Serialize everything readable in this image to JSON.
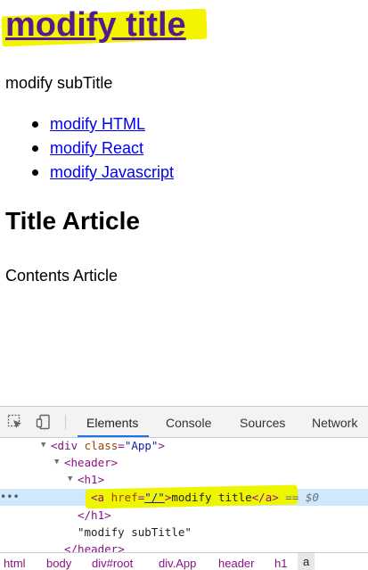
{
  "page": {
    "title": "modify title",
    "subtitle": "modify subTitle",
    "nav": [
      "modify HTML",
      "modify React",
      "modify Javascript"
    ],
    "article_title": "Title Article",
    "article_body": "Contents Article"
  },
  "devtools": {
    "tools": [
      "inspect-element-icon",
      "device-toolbar-icon"
    ],
    "tabs": [
      "Elements",
      "Console",
      "Sources",
      "Network"
    ],
    "active_tab": "Elements",
    "tree": {
      "div_open": "<div",
      "div_attr_name": "class",
      "div_attr_value": "\"App\"",
      "div_close": ">",
      "header_open": "<header>",
      "h1_open": "<h1>",
      "a_open": "<a",
      "a_attr_name": "href",
      "a_attr_value": "\"/\"",
      "a_open_end": ">",
      "a_text": "modify title",
      "a_close": "</a>",
      "selected_suffix": "== $0",
      "h1_close": "</h1>",
      "subtitle_text": "\"modify subTitle\"",
      "header_close": "</header>",
      "row_dots": "•••"
    },
    "breadcrumbs": [
      "html",
      "body",
      "div#root",
      "div.App",
      "header",
      "h1",
      "a"
    ]
  },
  "colors": {
    "highlight": "#f4f400",
    "visited_link": "#551a8b",
    "link": "#0000ee",
    "tag": "#881280",
    "attr_name": "#994500",
    "attr_value": "#1a1aa6",
    "selected_row": "#cfe8fc",
    "active_tab_underline": "#1a73e8"
  }
}
